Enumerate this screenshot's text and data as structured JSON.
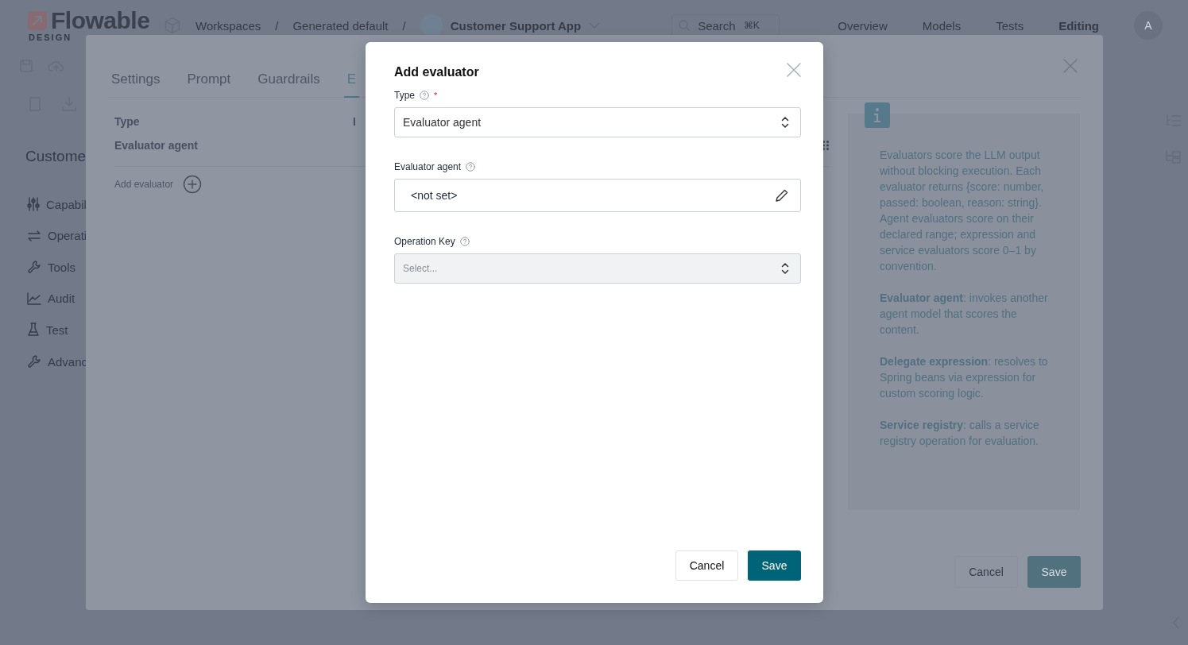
{
  "header": {
    "logo": "Flowable",
    "logo_sub": "DESIGN",
    "breadcrumbs": [
      "Workspaces",
      "Generated default",
      "Customer Support App"
    ],
    "separators": [
      "/",
      "/"
    ],
    "search": {
      "placeholder": "Search",
      "shortcut": "⌘K"
    },
    "nav": [
      {
        "label": "Overview",
        "selected": false
      },
      {
        "label": "Models",
        "selected": false
      },
      {
        "label": "Tests",
        "selected": false
      },
      {
        "label": "Editing",
        "selected": true
      }
    ],
    "avatar": "A"
  },
  "page": {
    "title": "Custome",
    "sidebar": [
      {
        "label": "Capabil",
        "kind": "sliders"
      },
      {
        "label": "Operati",
        "kind": "arrows"
      },
      {
        "label": "Tools",
        "kind": "wrench"
      },
      {
        "label": "Audit",
        "kind": "chart"
      },
      {
        "label": "Test",
        "kind": "flask"
      },
      {
        "label": "Advanc",
        "kind": "wrench"
      }
    ]
  },
  "editor": {
    "tabs": [
      {
        "label": "Settings",
        "selected": false
      },
      {
        "label": "Prompt",
        "selected": false
      },
      {
        "label": "Guardrails",
        "selected": false
      },
      {
        "label": "E",
        "selected": true
      }
    ],
    "table": {
      "columns": [
        "Type",
        "I"
      ],
      "rows": [
        [
          "Evaluator agent"
        ]
      ]
    },
    "add_label": "Add evaluator",
    "info": [
      "Evaluators score the LLM output without blocking execution. Each evaluator returns {score: number, passed: boolean, reason: string}. Agent evaluators score on their declared range; expression and service evaluators score 0–1 by convention.",
      "**Evaluator agent**: invokes another agent model that scores the content.",
      "**Delegate expression**: resolves to Spring beans via expression for custom scoring logic.",
      "**Service registry**: calls a service registry operation for evaluation."
    ],
    "buttons": [
      {
        "label": "Cancel",
        "kind": "secondary"
      },
      {
        "label": "Save",
        "kind": "primary"
      }
    ]
  },
  "dialog": {
    "title": "Add evaluator",
    "fields": [
      {
        "kind": "select",
        "label": "Type",
        "required_mark": "*",
        "value": "Evaluator agent",
        "disabled": false
      },
      {
        "kind": "picker",
        "label": "Evaluator agent",
        "value": "<not set>",
        "disabled": false
      },
      {
        "kind": "select",
        "label": "Operation Key",
        "placeholder": "Select...",
        "disabled": true
      }
    ],
    "buttons": [
      {
        "label": "Cancel",
        "kind": "secondary"
      },
      {
        "label": "Save",
        "kind": "primary"
      }
    ]
  }
}
